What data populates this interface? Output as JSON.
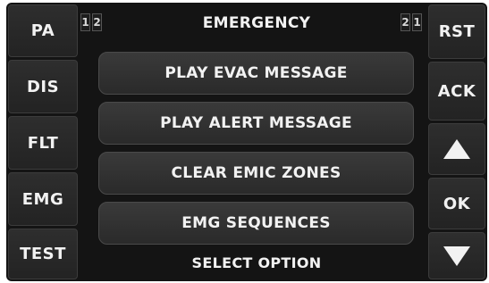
{
  "left_buttons": [
    {
      "label": "PA"
    },
    {
      "label": "DIS"
    },
    {
      "label": "FLT"
    },
    {
      "label": "EMG"
    },
    {
      "label": "TEST"
    }
  ],
  "right_buttons": {
    "rst": "RST",
    "ack": "ACK",
    "up_icon": "arrow-up-icon",
    "ok": "OK",
    "down_icon": "arrow-down-icon"
  },
  "header": {
    "title": "EMERGENCY",
    "left_indicator": [
      "1",
      "2"
    ],
    "right_indicator": [
      "2",
      "1"
    ]
  },
  "menu": {
    "options": [
      {
        "label": "PLAY EVAC MESSAGE"
      },
      {
        "label": "PLAY ALERT MESSAGE"
      },
      {
        "label": "CLEAR EMIC ZONES"
      },
      {
        "label": "EMG SEQUENCES"
      }
    ]
  },
  "status_text": "SELECT OPTION",
  "colors": {
    "background": "#141414",
    "button": "#2a2a2a",
    "text": "#f2f2f2"
  }
}
